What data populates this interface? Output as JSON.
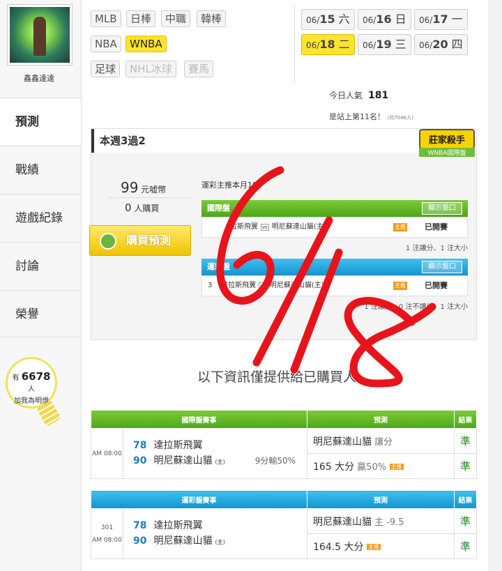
{
  "sidebar": {
    "username": "鑫鑫達達",
    "nav": [
      {
        "label": "預測"
      },
      {
        "label": "戰績"
      },
      {
        "label": "遊戲紀錄"
      },
      {
        "label": "討論"
      },
      {
        "label": "榮譽"
      }
    ],
    "fans": {
      "prefix": "有",
      "count": "6678",
      "unit": "人",
      "line2": "加我為明燈"
    }
  },
  "sports": [
    "MLB",
    "日棒",
    "中職",
    "韓棒",
    "NBA",
    "WNBA",
    "足球",
    "NHL冰球",
    "賽馬"
  ],
  "dates": [
    {
      "md": "06/",
      "d": "15",
      "w": "六"
    },
    {
      "md": "06/",
      "d": "16",
      "w": "日"
    },
    {
      "md": "06/",
      "d": "17",
      "w": "一"
    },
    {
      "md": "06/",
      "d": "18",
      "w": "二"
    },
    {
      "md": "06/",
      "d": "19",
      "w": "三"
    },
    {
      "md": "06/",
      "d": "20",
      "w": "四"
    }
  ],
  "popularity": {
    "label": "今日人氣",
    "value": "181",
    "rank": "是站上第11名！",
    "total": "(共7046人)"
  },
  "box": {
    "title": "本週3過2",
    "badge_top": "莊家殺手",
    "badge_bottom": "WNBA國際盤",
    "price_value": "99",
    "price_unit": "元嘘幣",
    "buyers_value": "0",
    "buyers_unit": "人購買",
    "buy_button": "購買預測",
    "reco_text": "運彩主推本月10",
    "panel1": {
      "title": "國際盤",
      "show": "顯示盤口",
      "away": "拉斯飛翼",
      "home": "明尼蘇達山貓(主)",
      "zhu": "主推",
      "status": "已開賽",
      "note": "1 注讓分、1 注大小"
    },
    "panel2": {
      "title": "運彩盤",
      "show": "顯示盤口",
      "num": "3",
      "away": "達拉斯飛翼",
      "home": "明尼蘇達山貓(主)",
      "zhu": "主推",
      "status": "已開賽",
      "note": "1 注讓分、0 注不讓分、1 注大小"
    }
  },
  "info_text": "以下資訊僅提供給已購買人",
  "vs_label": "vs",
  "home_mark": "(主)",
  "table1": {
    "headers": [
      "國際盤賽事",
      "預測",
      "結果"
    ],
    "time": "AM 08:00",
    "away_num": "78",
    "away": "達拉斯飛翼",
    "home_num": "90",
    "home": "明尼蘇達山貓",
    "result_note": "9分輸50%",
    "pred1": "明尼蘇達山貓",
    "pred1_sub": "讓分",
    "res1": "準",
    "pred2": "165 大分",
    "pred2_sub": "贏50%",
    "pred2_tag": "主推",
    "res2": "準"
  },
  "table2": {
    "headers": [
      "運彩盤賽事",
      "預測",
      "結果"
    ],
    "game_no": "301",
    "time": "AM 08:00",
    "away_num": "78",
    "away": "達拉斯飛翼",
    "home_num": "90",
    "home": "明尼蘇達山貓",
    "pred1": "明尼蘇達山貓",
    "pred1_sub": "主 -9.5",
    "res1": "準",
    "pred2": "164.5 大分",
    "pred2_tag": "主推",
    "res2": "準"
  },
  "overlay_text": "6/18",
  "colors": {
    "highlight": "#ffe42e",
    "green": "#5fb626",
    "blue": "#1ea6dc",
    "handwriting": "#e8141c"
  }
}
